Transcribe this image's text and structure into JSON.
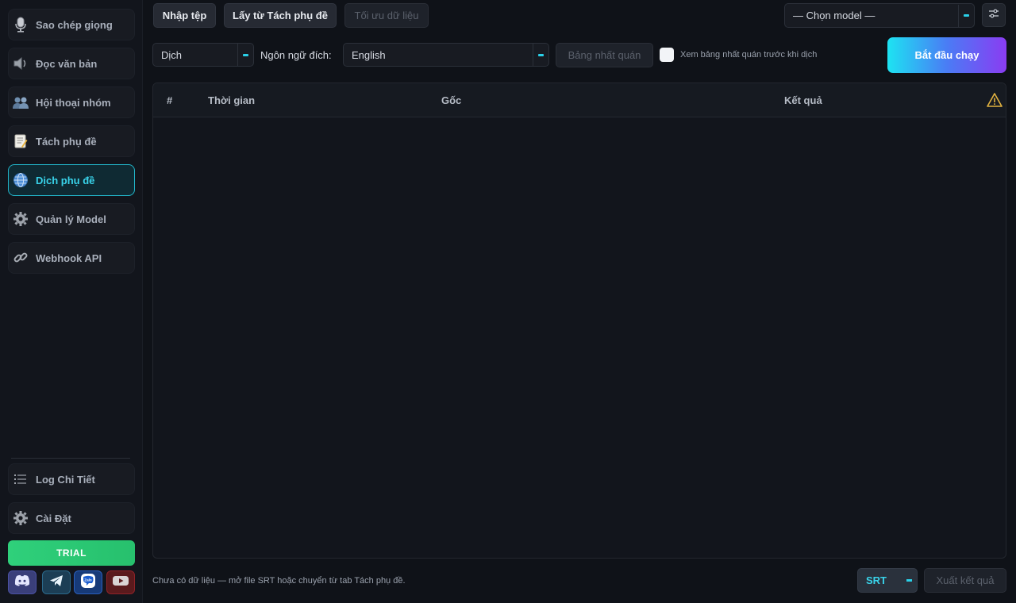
{
  "sidebar": {
    "items": [
      {
        "label": "Sao chép giọng",
        "icon": "microphone-icon"
      },
      {
        "label": "Đọc văn bản",
        "icon": "speaker-icon"
      },
      {
        "label": "Hội thoại nhóm",
        "icon": "people-icon"
      },
      {
        "label": "Tách phụ đề",
        "icon": "memo-icon"
      },
      {
        "label": "Dịch phụ đề",
        "icon": "globe-icon",
        "active": true
      },
      {
        "label": "Quản lý Model",
        "icon": "gear-icon"
      },
      {
        "label": "Webhook API",
        "icon": "link-icon"
      }
    ],
    "bottom_items": [
      {
        "label": "Log Chi Tiết",
        "icon": "list-icon"
      },
      {
        "label": "Cài Đặt",
        "icon": "gear-icon"
      }
    ],
    "trial_label": "TRIAL",
    "social": [
      "discord-icon",
      "telegram-icon",
      "zalo-icon",
      "youtube-icon"
    ]
  },
  "toolbar": {
    "import_label": "Nhập tệp",
    "fetch_label": "Lấy từ Tách phụ đề",
    "optimize_label": "Tối ưu dữ liệu",
    "model_select": "— Chọn model —",
    "mode_select": "Dịch",
    "target_lang_label": "Ngôn ngữ đích:",
    "target_lang_value": "English",
    "consistency_label": "Bảng nhất quán",
    "consistency_check_label": "Xem bảng nhất quán trước khi dịch",
    "start_label": "Bắt đầu chạy"
  },
  "table": {
    "columns": [
      "#",
      "Thời gian",
      "Gốc",
      "Kết quả"
    ],
    "rows": []
  },
  "footer": {
    "status": "Chưa có dữ liệu — mở file SRT hoặc chuyển từ tab Tách phụ đề.",
    "format_value": "SRT",
    "export_label": "Xuất kết quả"
  },
  "colors": {
    "accent": "#2ad0e8",
    "trial": "#2fd07b",
    "start_gradient": [
      "#1de3f2",
      "#8a3cf2"
    ]
  }
}
